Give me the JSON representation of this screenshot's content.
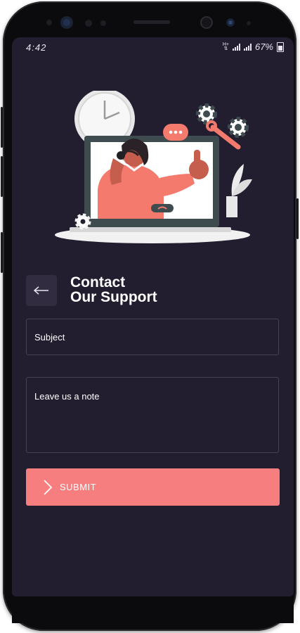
{
  "status_bar": {
    "time": "4:42",
    "battery": "67%"
  },
  "header": {
    "title_line1": "Contact",
    "title_line2": "Our Support"
  },
  "form": {
    "subject_placeholder": "Subject",
    "note_placeholder": "Leave us a note"
  },
  "submit_button": {
    "label": "SUBMIT"
  },
  "colors": {
    "background": "#221d2f",
    "accent": "#f77e7e",
    "field_border": "#464157"
  }
}
